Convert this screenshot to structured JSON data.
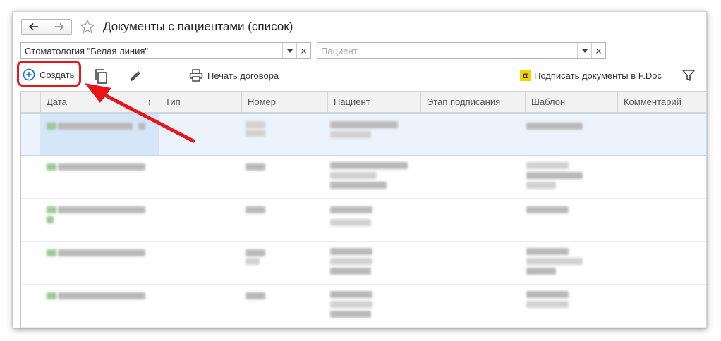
{
  "window": {
    "title": "Документы с пациентами (список)"
  },
  "filters": {
    "clinic_value": "Стоматология \"Белая линия\"",
    "patient_placeholder": "Пациент"
  },
  "toolbar": {
    "create_label": "Создать",
    "print_label": "Печать договора",
    "sign_label": "Подписать документы в F.Doc",
    "fdoc_logo_text": "α"
  },
  "table": {
    "columns": [
      {
        "label": "Дата"
      },
      {
        "label": "Тип"
      },
      {
        "label": "Номер"
      },
      {
        "label": "Пациент"
      },
      {
        "label": "Этап подписания"
      },
      {
        "label": "Шаблон"
      },
      {
        "label": "Комментарий"
      }
    ],
    "sort_indicator": "↑"
  },
  "colors": {
    "accent_red": "#e8151b",
    "create_icon_blue": "#1d6fd0",
    "selection_bg": "#edf3fc",
    "fdoc_yellow": "#f3d200"
  },
  "icons": [
    "back-arrow-icon",
    "forward-arrow-icon",
    "star-icon",
    "dropdown-icon",
    "clear-icon",
    "plus-circle-icon",
    "copy-icon",
    "pencil-icon",
    "printer-icon",
    "fdoc-logo-icon",
    "funnel-icon"
  ]
}
